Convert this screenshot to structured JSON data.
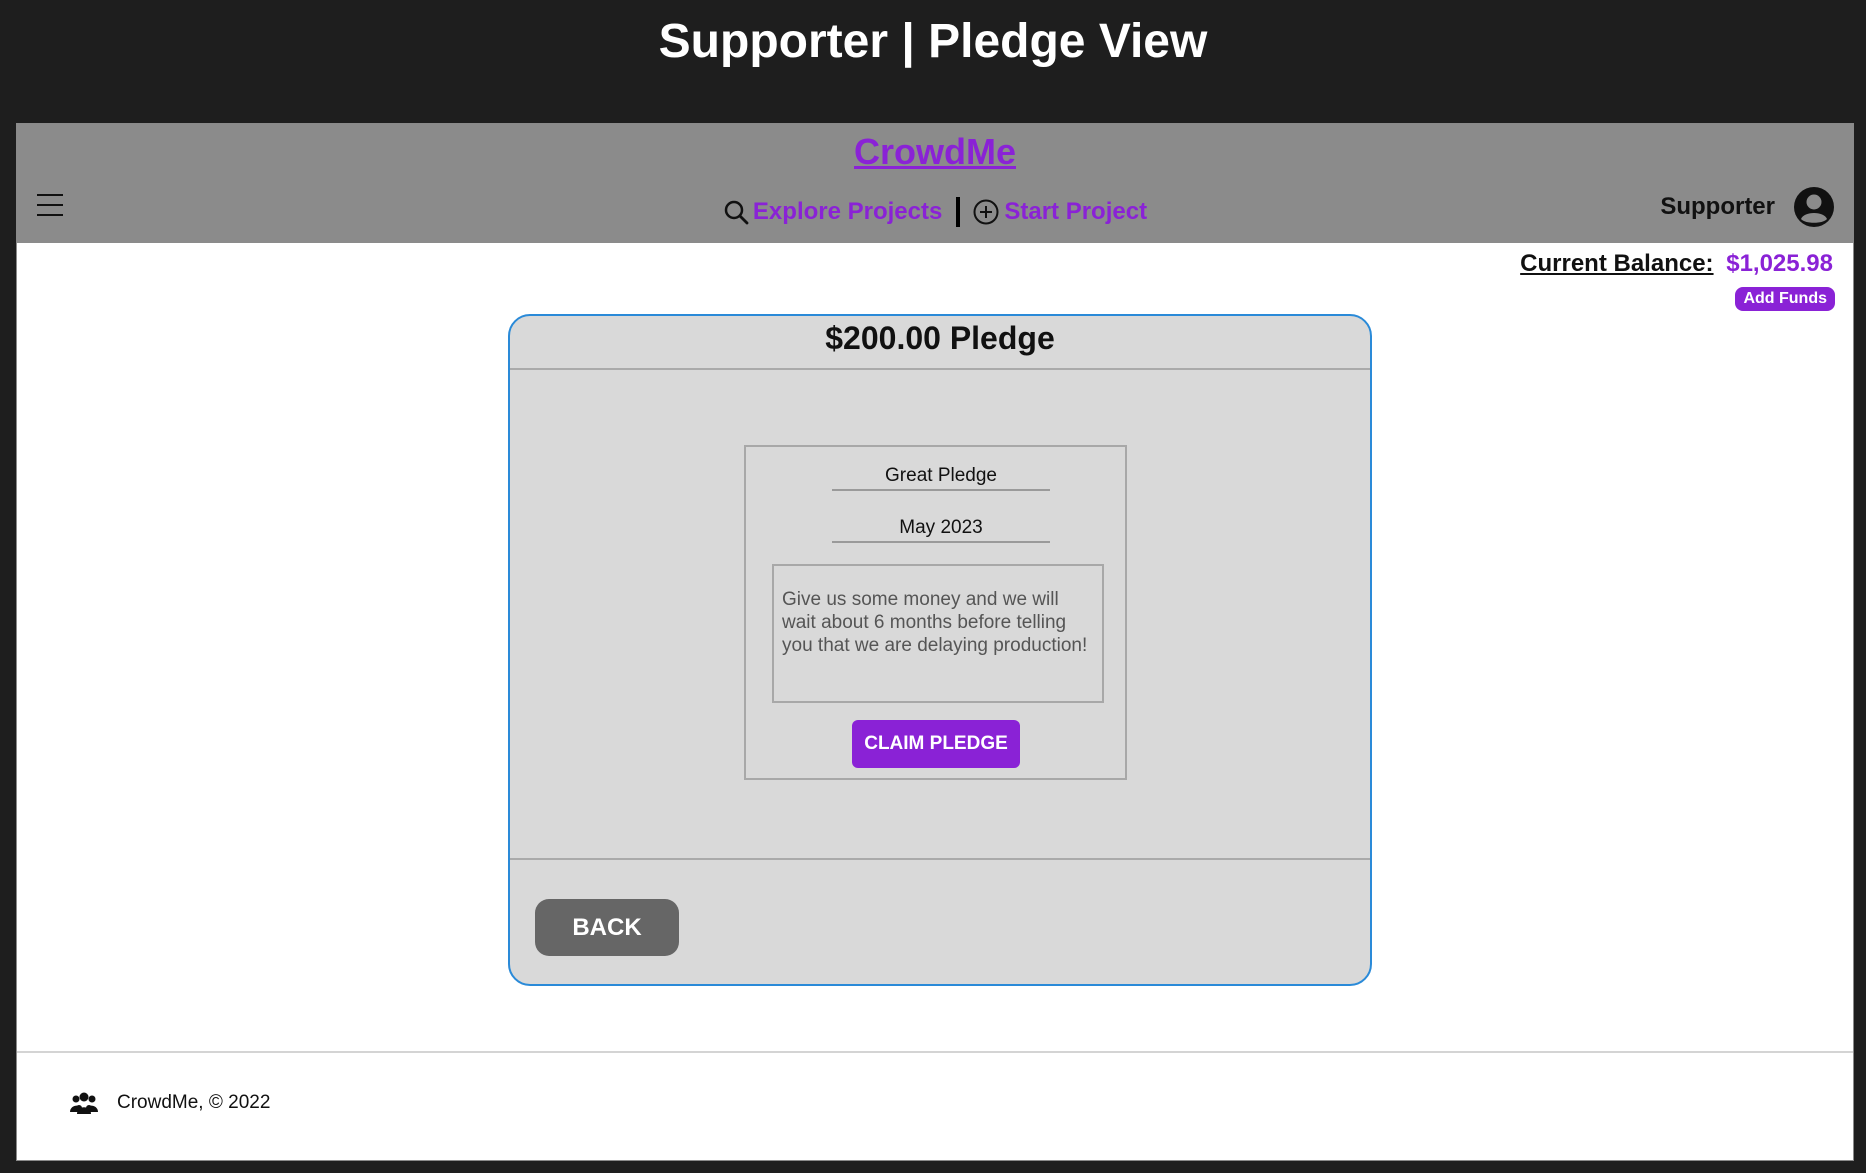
{
  "page_title": "Supporter | Pledge View",
  "header": {
    "brand": "CrowdMe",
    "nav": {
      "explore_label": "Explore Projects",
      "explore_icon": "search-icon",
      "start_label": "Start Project",
      "start_icon": "plus-circle-icon"
    },
    "user": {
      "name": "Supporter",
      "icon": "user-avatar-icon"
    },
    "menu_icon": "hamburger-menu-icon"
  },
  "balance": {
    "label": "Current Balance:",
    "value": "$1,025.98",
    "add_funds_label": "Add Funds"
  },
  "pledge": {
    "title": "$200.00 Pledge",
    "reward_name": "Great Pledge",
    "reward_date": "May 2023",
    "description": "Give us some money and we will wait about 6 months before telling you that we are delaying production!",
    "claim_label": "CLAIM PLEDGE"
  },
  "back_label": "BACK",
  "footer": {
    "text": "CrowdMe, © 2022",
    "icon": "users-group-icon"
  },
  "colors": {
    "accent": "#8a22d6",
    "header_bg": "#8b8b8b",
    "card_border": "#2a8ad8",
    "card_bg": "#d9d9d9"
  }
}
